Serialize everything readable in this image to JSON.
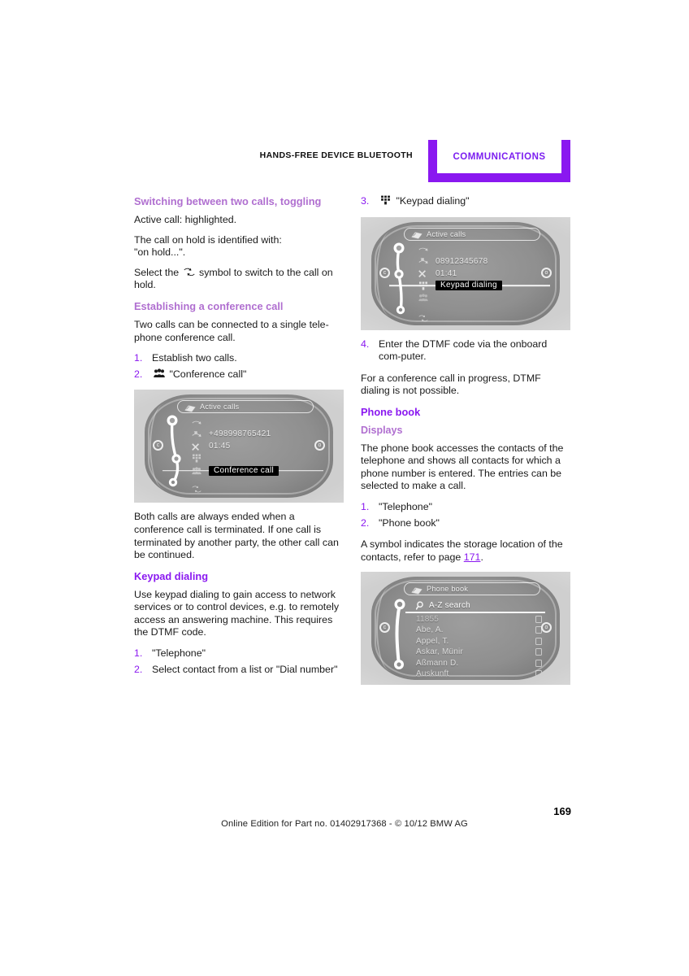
{
  "header": {
    "running_title": "HANDS-FREE DEVICE BLUETOOTH",
    "tab_label": "COMMUNICATIONS",
    "accent_color": "#8a18f0",
    "tab_fill": "#8a18f0"
  },
  "left_column": {
    "section1_heading": "Switching between two calls, toggling",
    "section1_p1": "Active call: highlighted.",
    "section1_p2_line1": "The call on hold is identified with:",
    "section1_p2_line2": "\"on hold...\".",
    "section1_p3_a": "Select the",
    "section1_p3_b": "symbol to switch to the call on hold.",
    "section2_heading": "Establishing a conference call",
    "section2_p1": "Two calls can be connected to a single tele-phone conference call.",
    "section2_steps": [
      {
        "num": "1.",
        "text": "Establish two calls."
      },
      {
        "num": "2.",
        "text": "\"Conference call\"",
        "icon": "conference-call-icon"
      }
    ],
    "section2_p2": "Both calls are always ended when a conference call is terminated. If one call is terminated by another party, the other call can be continued.",
    "section3_heading": "Keypad dialing",
    "section3_p1": "Use keypad dialing to gain access to network services or to control devices, e.g. to remotely access an answering machine. This requires the DTMF code.",
    "section3_steps": [
      {
        "num": "1.",
        "text": "\"Telephone\""
      },
      {
        "num": "2.",
        "text": "Select contact from a list or \"Dial number\""
      }
    ]
  },
  "right_column": {
    "step3": {
      "num": "3.",
      "text": "\"Keypad dialing\"",
      "icon": "keypad-icon"
    },
    "step4": {
      "num": "4.",
      "text": "Enter the DTMF code via the onboard com-puter."
    },
    "p_after_step4": "For a conference call in progress, DTMF dialing is not possible.",
    "section_phonebook_heading": "Phone book",
    "section_displays_heading": "Displays",
    "displays_p1": "The phone book accesses the contacts of the telephone and shows all contacts for which a phone number is entered. The entries can be selected to make a call.",
    "displays_steps": [
      {
        "num": "1.",
        "text": "\"Telephone\""
      },
      {
        "num": "2.",
        "text": "\"Phone book\""
      }
    ],
    "displays_p2_a": "A symbol indicates the storage location of the contacts, refer to page",
    "displays_p2_link": "171",
    "displays_p2_b": "."
  },
  "screenshot_conference": {
    "title": "Active calls",
    "rows": [
      {
        "icon": "call-dropped-icon",
        "text": ""
      },
      {
        "icon": "call-active-icon",
        "text": "+498998765421"
      },
      {
        "icon": "end-call-icon",
        "text": "01:45"
      },
      {
        "icon": "keypad-icon",
        "text": ""
      },
      {
        "icon": "conference-call-icon",
        "text": "Conference call",
        "selected": true
      },
      {
        "icon": "swap-calls-icon",
        "text": ""
      }
    ],
    "left_knob": "c",
    "right_knob": "o"
  },
  "screenshot_keypad": {
    "title": "Active calls",
    "rows": [
      {
        "icon": "call-dropped-icon",
        "text": ""
      },
      {
        "icon": "call-active-icon",
        "text": "08912345678"
      },
      {
        "icon": "end-call-icon",
        "text": "01:41"
      },
      {
        "icon": "keypad-icon",
        "text": "Keypad dialing",
        "selected": true
      },
      {
        "icon": "conference-call-icon",
        "text": ""
      },
      {
        "icon": "swap-calls-icon",
        "text": ""
      }
    ],
    "left_knob": "c",
    "right_knob": "o"
  },
  "screenshot_phonebook": {
    "title": "Phone book",
    "search_label": "A-Z search",
    "entries": [
      {
        "name": "11855",
        "badge": "□"
      },
      {
        "name": "Abe, A.",
        "badge": "□"
      },
      {
        "name": "Appel, T.",
        "badge": "□"
      },
      {
        "name": "Askar, Münir",
        "badge": "□"
      },
      {
        "name": "Aßmann D.",
        "badge": "□"
      },
      {
        "name": "Auskunft",
        "badge": "□"
      }
    ],
    "left_knob": "c",
    "right_knob": "o"
  },
  "footer": {
    "page_number": "169",
    "note": "Online Edition for Part no. 01402917368 - © 10/12 BMW AG"
  }
}
